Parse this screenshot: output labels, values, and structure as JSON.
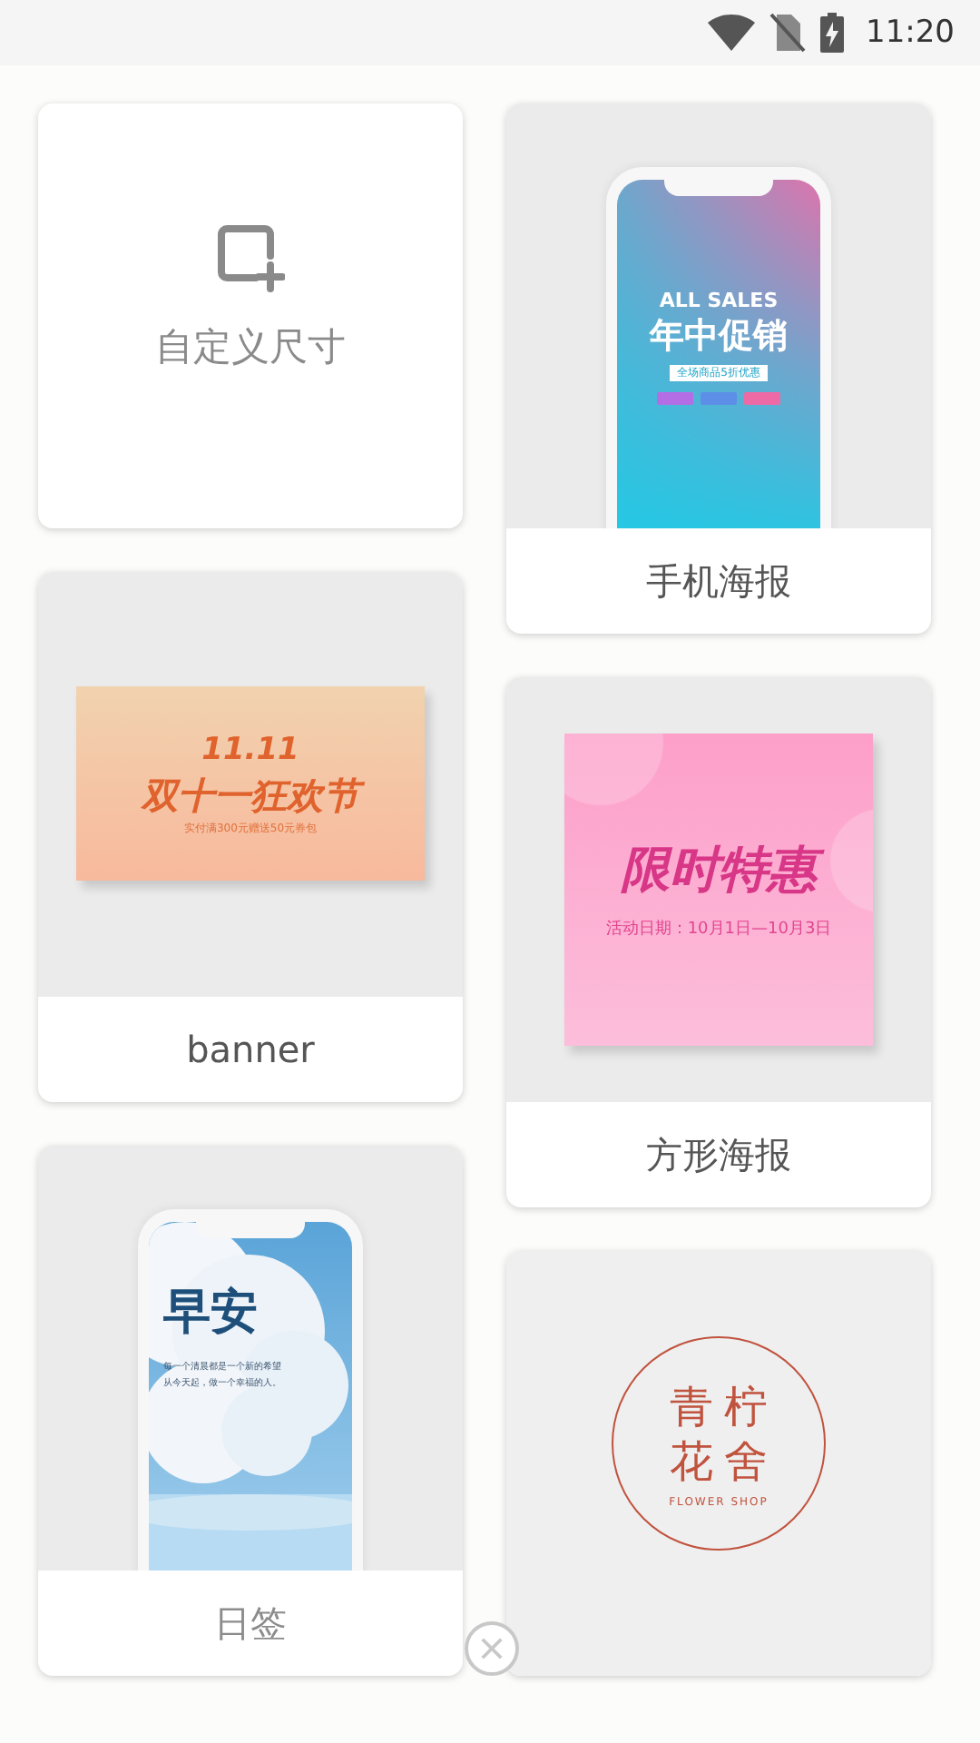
{
  "status_bar": {
    "time": "11:20"
  },
  "columns": [
    [
      {
        "kind": "custom",
        "label": "自定义尺寸"
      },
      {
        "kind": "banner",
        "label": "banner",
        "preview": {
          "headline": "11.11",
          "title": "双十一狂欢节",
          "subtitle": "实付满300元赠送50元券包"
        }
      },
      {
        "kind": "sign",
        "label": "日签",
        "preview": {
          "title": "早安",
          "lines": [
            "每一个清晨都是一个新的希望",
            "从今天起，做一个幸福的人。"
          ]
        }
      }
    ],
    [
      {
        "kind": "phone",
        "label": "手机海报",
        "preview": {
          "headline": "ALL SALES",
          "title": "年中促销",
          "subtitle": "全场商品5折优惠"
        }
      },
      {
        "kind": "square",
        "label": "方形海报",
        "preview": {
          "title": "限时特惠",
          "subtitle": "活动日期：10月1日—10月3日"
        }
      },
      {
        "kind": "logo",
        "preview": {
          "title_lines": [
            "青柠",
            "花舍"
          ],
          "subtitle": "FLOWER SHOP"
        }
      }
    ]
  ]
}
